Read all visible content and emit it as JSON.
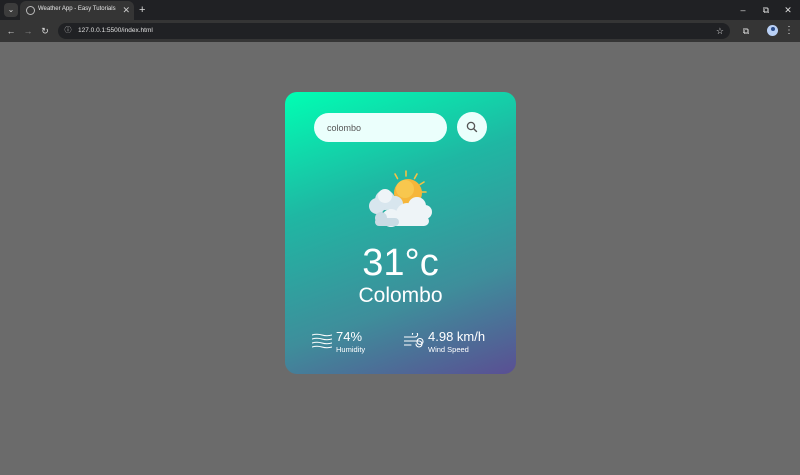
{
  "browser": {
    "tab_title": "Weather App - Easy Tutorials",
    "url": "127.0.0.1:5500/index.html",
    "tab_list_icon": "chevron-down-icon",
    "new_tab_icon": "plus-icon"
  },
  "weather": {
    "search": {
      "value": "colombo",
      "placeholder": ""
    },
    "condition_icon": "sun-behind-clouds-icon",
    "temperature": "31°c",
    "city": "Colombo",
    "humidity": {
      "value": "74%",
      "label": "Humidity",
      "icon": "humidity-icon"
    },
    "wind": {
      "value": "4.98 km/h",
      "label": "Wind Speed",
      "icon": "wind-icon"
    }
  },
  "colors": {
    "card_gradient_start": "#00ffb3",
    "card_gradient_end": "#5a4f93",
    "page_background": "#6b6b6b"
  }
}
